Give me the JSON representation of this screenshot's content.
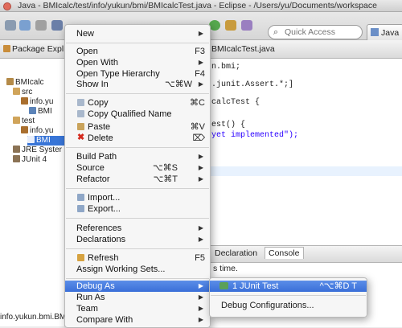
{
  "window": {
    "title": "Java - BMIcalc/test/info/yukun/bmi/BMIcalcTest.java - Eclipse - /Users/yu/Documents/workspace"
  },
  "toolbar": {
    "quick_access_placeholder": "Quick Access",
    "perspective_label": "Java"
  },
  "package_explorer": {
    "title": "Package Expl",
    "tree": [
      {
        "label": "BMIcalc",
        "icon": "project-icon"
      },
      {
        "label": "src",
        "icon": "source-folder-icon"
      },
      {
        "label": "info.yu",
        "icon": "package-icon"
      },
      {
        "label": "BMI",
        "icon": "java-file-icon"
      },
      {
        "label": "test",
        "icon": "source-folder-icon"
      },
      {
        "label": "info.yu",
        "icon": "package-icon"
      },
      {
        "label": "BMI",
        "icon": "java-file-icon"
      },
      {
        "label": "JRE Syster",
        "icon": "library-icon"
      },
      {
        "label": "JUnit 4",
        "icon": "library-icon"
      }
    ],
    "status": "info.yukun.bmi.BMIcalc"
  },
  "editor": {
    "tab_label": "BMIcalcTest.java",
    "code_lines": [
      "n.bmi;",
      ".junit.Assert.*;]",
      "calcTest {",
      "est() {",
      "yet implemented\");"
    ]
  },
  "bottom_panel": {
    "tabs": [
      "Declaration",
      "Console"
    ],
    "content": "s time."
  },
  "context_menu": {
    "items": [
      {
        "label": "New",
        "shortcut": "",
        "submenu": true
      },
      {
        "label": "Open",
        "shortcut": "F3",
        "submenu": false
      },
      {
        "label": "Open With",
        "shortcut": "",
        "submenu": true
      },
      {
        "label": "Open Type Hierarchy",
        "shortcut": "F4",
        "submenu": false
      },
      {
        "label": "Show In",
        "shortcut": "⌥⌘W",
        "submenu": true
      },
      {
        "label": "Copy",
        "shortcut": "⌘C",
        "submenu": false,
        "icon": "copy-icon"
      },
      {
        "label": "Copy Qualified Name",
        "shortcut": "",
        "submenu": false,
        "icon": "copy-qualified-icon"
      },
      {
        "label": "Paste",
        "shortcut": "⌘V",
        "submenu": false,
        "icon": "paste-icon"
      },
      {
        "label": "Delete",
        "shortcut": "⌦",
        "submenu": false,
        "icon": "delete-icon"
      },
      {
        "label": "Build Path",
        "shortcut": "",
        "submenu": true
      },
      {
        "label": "Source",
        "shortcut": "⌥⌘S",
        "submenu": true
      },
      {
        "label": "Refactor",
        "shortcut": "⌥⌘T",
        "submenu": true
      },
      {
        "label": "Import...",
        "shortcut": "",
        "submenu": false,
        "icon": "import-icon"
      },
      {
        "label": "Export...",
        "shortcut": "",
        "submenu": false,
        "icon": "export-icon"
      },
      {
        "label": "References",
        "shortcut": "",
        "submenu": true
      },
      {
        "label": "Declarations",
        "shortcut": "",
        "submenu": true
      },
      {
        "label": "Refresh",
        "shortcut": "F5",
        "submenu": false,
        "icon": "refresh-icon"
      },
      {
        "label": "Assign Working Sets...",
        "shortcut": "",
        "submenu": false
      },
      {
        "label": "Debug As",
        "shortcut": "",
        "submenu": true
      },
      {
        "label": "Run As",
        "shortcut": "",
        "submenu": true
      },
      {
        "label": "Team",
        "shortcut": "",
        "submenu": true
      },
      {
        "label": "Compare With",
        "shortcut": "",
        "submenu": true
      }
    ]
  },
  "debug_submenu": {
    "items": [
      {
        "label": "1 JUnit Test",
        "shortcut": "^⌥⌘D T",
        "icon": "junit-icon"
      },
      {
        "label": "Debug Configurations...",
        "shortcut": ""
      }
    ]
  },
  "colors": {
    "highlight": "#3a6fd8",
    "selection": "#3875d7",
    "keyword": "#7f0055",
    "string": "#2a00ff"
  }
}
